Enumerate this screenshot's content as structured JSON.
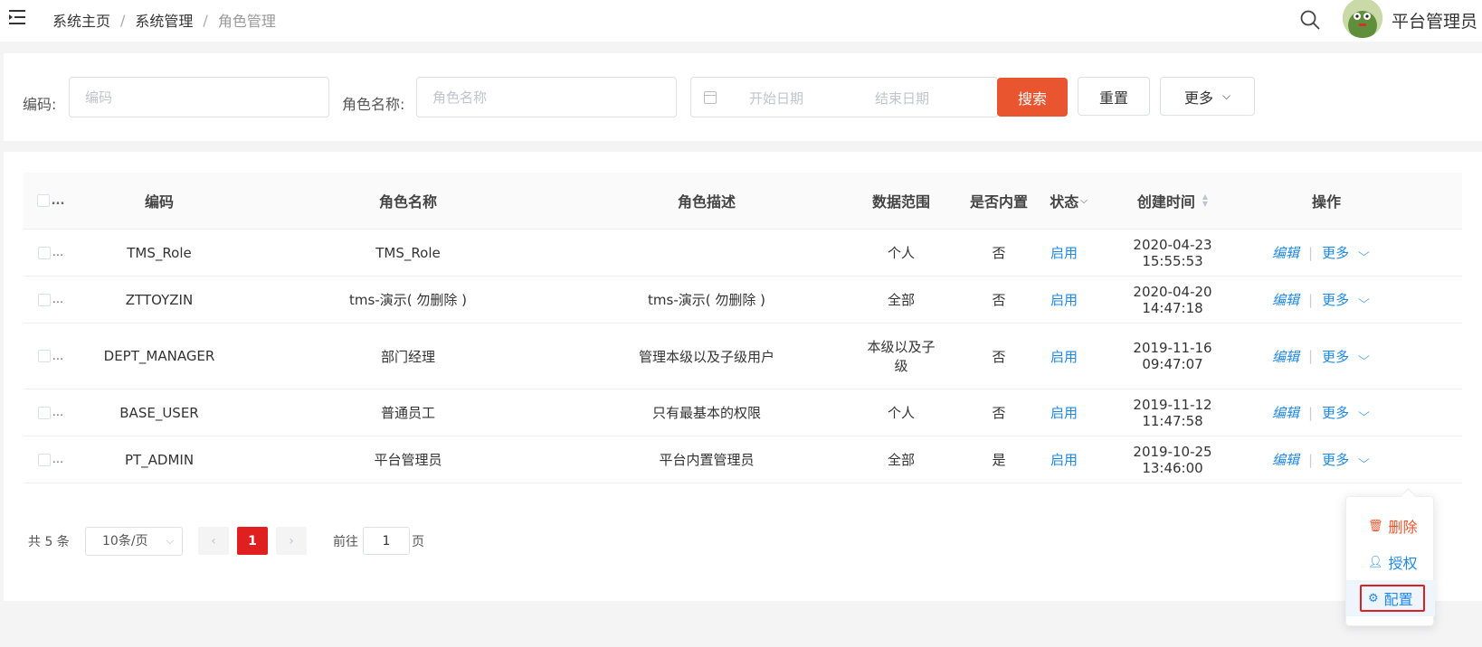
{
  "header": {
    "breadcrumb": [
      "系统主页",
      "系统管理",
      "角色管理"
    ],
    "username": "平台管理员"
  },
  "search": {
    "code_label": "编码:",
    "code_placeholder": "编码",
    "role_label": "角色名称:",
    "role_placeholder": "角色名称",
    "start_placeholder": "开始日期",
    "end_placeholder": "结束日期",
    "search_button": "搜索",
    "reset_button": "重置",
    "more_button": "更多"
  },
  "table": {
    "columns": {
      "select": "...",
      "code": "编码",
      "name": "角色名称",
      "desc": "角色描述",
      "scope": "数据范围",
      "builtin": "是否内置",
      "status": "状态",
      "created": "创建时间",
      "ops": "操作"
    },
    "rows": [
      {
        "select": "...",
        "code": "TMS_Role",
        "name": "TMS_Role",
        "desc": "",
        "scope": "个人",
        "builtin": "否",
        "status": "启用",
        "created": "2020-04-23 15:55:53",
        "edit": "编辑",
        "more": "更多"
      },
      {
        "select": "...",
        "code": "ZTTOYZIN",
        "name": "tms-演示( 勿删除 )",
        "desc": "tms-演示( 勿删除 )",
        "scope": "全部",
        "builtin": "否",
        "status": "启用",
        "created": "2020-04-20 14:47:18",
        "edit": "编辑",
        "more": "更多"
      },
      {
        "select": "...",
        "code": "DEPT_MANAGER",
        "name": "部门经理",
        "desc": "管理本级以及子级用户",
        "scope": "本级以及子级",
        "builtin": "否",
        "status": "启用",
        "created": "2019-11-16 09:47:07",
        "edit": "编辑",
        "more": "更多"
      },
      {
        "select": "...",
        "code": "BASE_USER",
        "name": "普通员工",
        "desc": "只有最基本的权限",
        "scope": "个人",
        "builtin": "否",
        "status": "启用",
        "created": "2019-11-12 11:47:58",
        "edit": "编辑",
        "more": "更多"
      },
      {
        "select": "...",
        "code": "PT_ADMIN",
        "name": "平台管理员",
        "desc": "平台内置管理员",
        "scope": "全部",
        "builtin": "是",
        "status": "启用",
        "created": "2019-10-25 13:46:00",
        "edit": "编辑",
        "more": "更多"
      }
    ]
  },
  "pagination": {
    "total": "共 5 条",
    "page_size": "10条/页",
    "current_page": "1",
    "goto_label": "前往",
    "goto_value": "1",
    "goto_suffix": "页"
  },
  "dropdown": {
    "items": [
      "删除",
      "授权",
      "配置"
    ]
  },
  "colors": {
    "primary": "#e8552e",
    "link": "#1e88e5",
    "active_page": "#e02020"
  }
}
